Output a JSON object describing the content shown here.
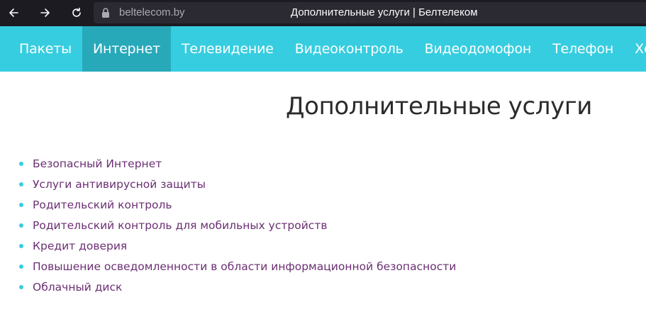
{
  "browser": {
    "url": "beltelecom.by",
    "title": "Дополнительные услуги | Белтелеком",
    "icons": [
      "back-arrow-icon",
      "forward-arrow-icon",
      "reload-icon",
      "lock-icon"
    ]
  },
  "nav": {
    "items": [
      {
        "label": "Пакеты",
        "active": false
      },
      {
        "label": "Интернет",
        "active": true
      },
      {
        "label": "Телевидение",
        "active": false
      },
      {
        "label": "Видеоконтроль",
        "active": false
      },
      {
        "label": "Видеодомофон",
        "active": false
      },
      {
        "label": "Телефон",
        "active": false
      },
      {
        "label": "Хостинг",
        "active": false
      }
    ]
  },
  "main": {
    "heading": "Дополнительные услуги",
    "services": [
      "Безопасный Интернет",
      "Услуги антивирусной защиты",
      "Родительский контроль",
      "Родительский контроль для мобильных устройств",
      "Кредит доверия",
      "Повышение осведомленности в области информационной безопасности",
      "Облачный диск"
    ]
  },
  "colors": {
    "accent": "#37cde0",
    "accent_active": "#28a9ba",
    "link": "#6b2f73",
    "chrome_bg": "#1c1b22"
  }
}
